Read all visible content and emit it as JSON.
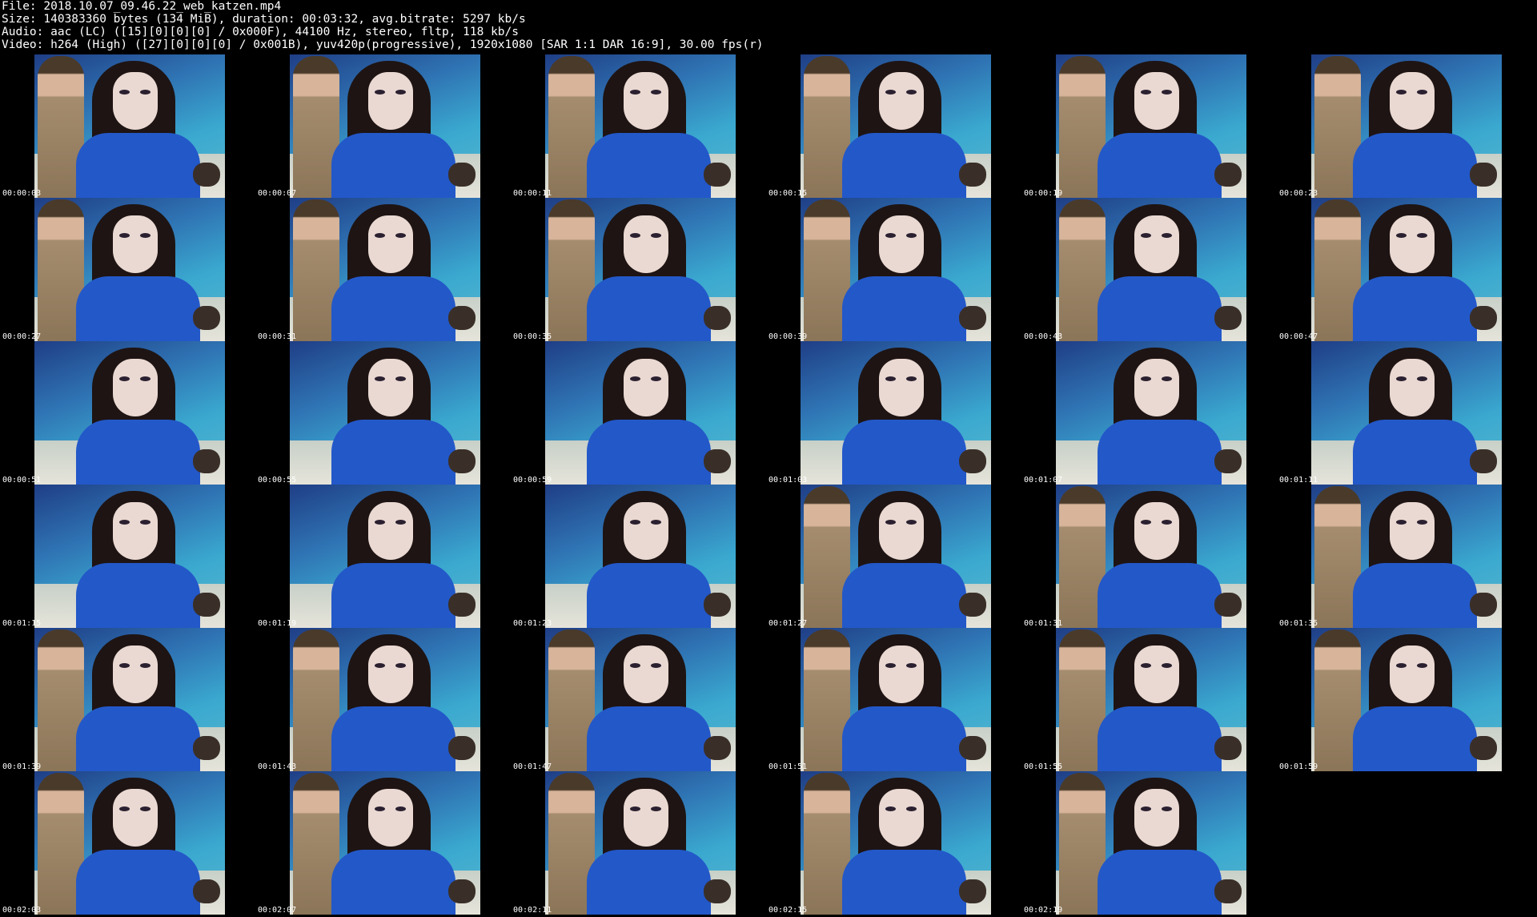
{
  "header": {
    "line1": "File: 2018.10.07_09.46.22_web_katzen.mp4",
    "line2": "Size: 140383360 bytes (134 MiB), duration: 00:03:32, avg.bitrate: 5297 kb/s",
    "line3": "Audio: aac (LC) ([15][0][0][0] / 0x000F), 44100 Hz, stereo, fltp, 118 kb/s",
    "line4": "Video: h264 (High) ([27][0][0][0] / 0x001B), yuv420p(progressive), 1920x1080 [SAR 1:1 DAR 16:9], 30.00 fps(r)"
  },
  "thumbnails": [
    {
      "time": "00:00:03"
    },
    {
      "time": "00:00:07"
    },
    {
      "time": "00:00:11"
    },
    {
      "time": "00:00:15"
    },
    {
      "time": "00:00:19"
    },
    {
      "time": "00:00:23"
    },
    {
      "time": "00:00:27"
    },
    {
      "time": "00:00:31"
    },
    {
      "time": "00:00:35"
    },
    {
      "time": "00:00:39"
    },
    {
      "time": "00:00:43"
    },
    {
      "time": "00:00:47"
    },
    {
      "time": "00:00:51"
    },
    {
      "time": "00:00:55"
    },
    {
      "time": "00:00:59"
    },
    {
      "time": "00:01:03"
    },
    {
      "time": "00:01:07"
    },
    {
      "time": "00:01:11"
    },
    {
      "time": "00:01:15"
    },
    {
      "time": "00:01:19"
    },
    {
      "time": "00:01:23"
    },
    {
      "time": "00:01:27"
    },
    {
      "time": "00:01:31"
    },
    {
      "time": "00:01:35"
    },
    {
      "time": "00:01:39"
    },
    {
      "time": "00:01:43"
    },
    {
      "time": "00:01:47"
    },
    {
      "time": "00:01:51"
    },
    {
      "time": "00:01:55"
    },
    {
      "time": "00:01:59"
    },
    {
      "time": "00:02:03"
    },
    {
      "time": "00:02:07"
    },
    {
      "time": "00:02:11"
    },
    {
      "time": "00:02:15"
    },
    {
      "time": "00:02:19"
    }
  ]
}
